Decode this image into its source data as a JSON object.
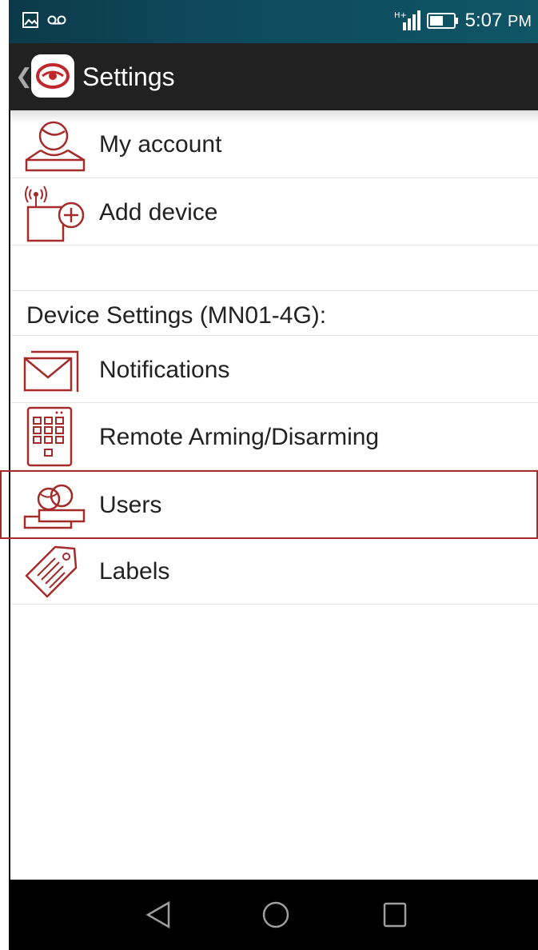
{
  "status_bar": {
    "time": "5:07",
    "ampm": "PM",
    "icons": [
      "image-icon",
      "voicemail-icon",
      "signal-icon",
      "battery-icon"
    ]
  },
  "app_bar": {
    "back_icon": "chevron-left-icon",
    "logo_icon": "eye-logo-icon",
    "title": "Settings"
  },
  "menu": {
    "my_account": "My account",
    "add_device": "Add device"
  },
  "device_settings": {
    "header": "Device Settings (MN01-4G):",
    "items": [
      {
        "label": "Notifications",
        "icon": "envelope-icon"
      },
      {
        "label": "Remote Arming/Disarming",
        "icon": "keypad-icon"
      },
      {
        "label": "Users",
        "icon": "users-icon"
      },
      {
        "label": "Labels",
        "icon": "tag-icon"
      }
    ]
  },
  "nav_bar": {
    "icons": [
      "back-triangle-icon",
      "home-circle-icon",
      "recents-square-icon"
    ]
  },
  "colors": {
    "accent": "#a52a2a",
    "status_bar": "#0e4a5c",
    "app_bar": "#212121",
    "nav_bar": "#000000"
  }
}
